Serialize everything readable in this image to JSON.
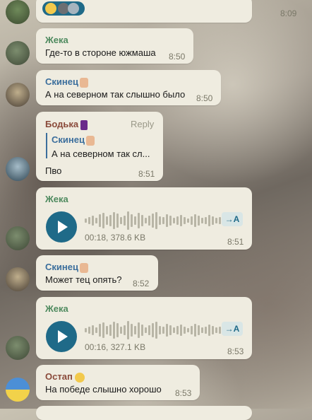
{
  "colors": {
    "bubble": "#efece0",
    "name_green": "#4e8a5e",
    "name_blue": "#3b6e9c",
    "name_brown": "#8a4a3a",
    "play": "#1f6a88"
  },
  "messages": [
    {
      "kind": "reactions",
      "time": "8:09"
    },
    {
      "kind": "text",
      "sender": "Жека",
      "text": "Где-то в стороне южмаша",
      "time": "8:50"
    },
    {
      "kind": "text",
      "sender": "Скинец",
      "sender_icon": "thumbs-up-emoji",
      "text": "А на северном так слышно было",
      "time": "8:50"
    },
    {
      "kind": "reply",
      "sender": "Бодька",
      "sender_icon": "dancer-emoji",
      "reply_label": "Reply",
      "quote_sender": "Скинец",
      "quote_text": "А на северном так сл...",
      "text": "Пво",
      "time": "8:51"
    },
    {
      "kind": "voice",
      "sender": "Жека",
      "meta": "00:18, 378.6 KB",
      "stt": "→A",
      "time": "8:51"
    },
    {
      "kind": "text",
      "sender": "Скинец",
      "sender_icon": "thumbs-up-emoji",
      "text": "Может тец опять?",
      "time": "8:52"
    },
    {
      "kind": "voice",
      "sender": "Жека",
      "meta": "00:16, 327.1 KB",
      "stt": "→A",
      "time": "8:53"
    },
    {
      "kind": "text",
      "sender": "Остап",
      "sender_icon": "mask-face-emoji",
      "text": "На победе слышно хорошо",
      "time": "8:53"
    }
  ]
}
